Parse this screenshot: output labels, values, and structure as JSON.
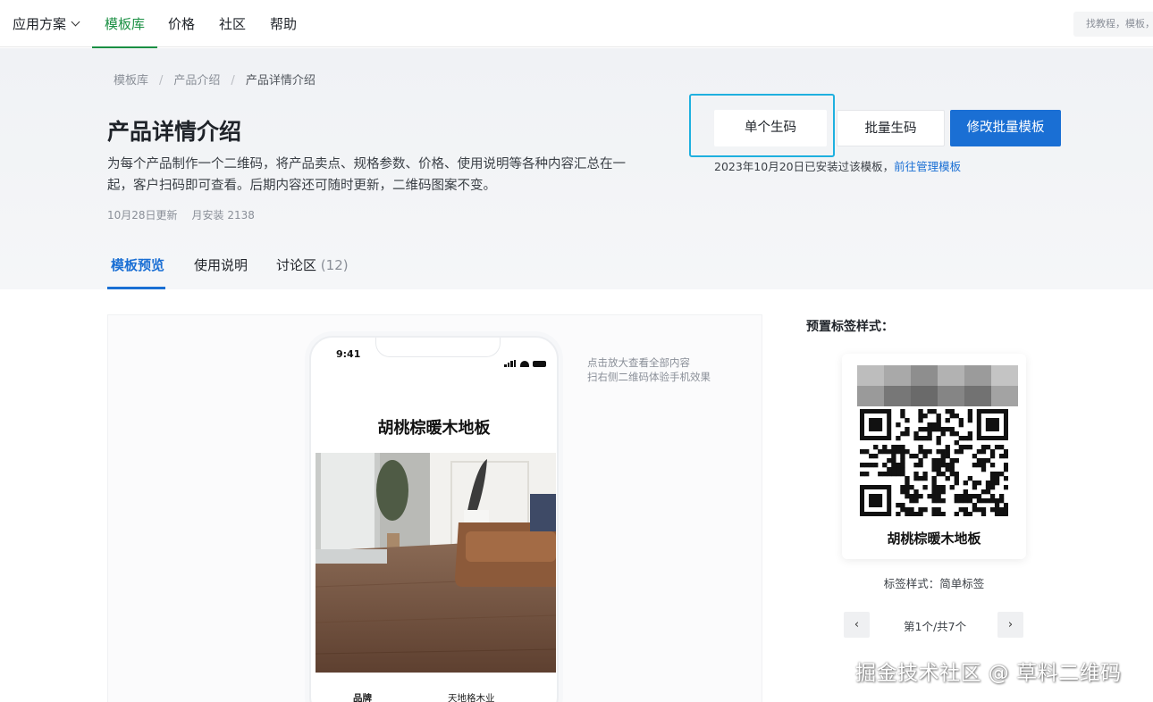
{
  "nav": {
    "items": [
      {
        "label": "应用方案",
        "has_dropdown": true
      },
      {
        "label": "模板库",
        "active": true
      },
      {
        "label": "价格"
      },
      {
        "label": "社区"
      },
      {
        "label": "帮助"
      }
    ],
    "search_placeholder": "找教程，模板，"
  },
  "colors": {
    "accent_green": "#1a8f43",
    "primary_blue": "#1a6fd4",
    "focus_cyan": "#1fb0df"
  },
  "breadcrumb": [
    "模板库",
    "产品介绍",
    "产品详情介绍"
  ],
  "breadcrumb_sep": "/",
  "hero": {
    "title": "产品详情介绍",
    "description": "为每个产品制作一个二维码，将产品卖点、规格参数、价格、使用说明等各种内容汇总在一起，客户扫码即可查看。后期内容还可随时更新，二维码图案不变。",
    "updated": "10月28日更新",
    "installs": "月安装 2138"
  },
  "actions": {
    "single": "单个生码",
    "batch": "批量生码",
    "edit_batch": "修改批量模板",
    "install_note": "2023年10月20日已安装过该模板，",
    "manage_link": "前往管理模板"
  },
  "tabs": [
    {
      "label": "模板预览",
      "active": true
    },
    {
      "label": "使用说明"
    },
    {
      "label": "讨论区",
      "count": "(12)"
    }
  ],
  "preview": {
    "phone_time": "9:41",
    "product_title": "胡桃棕暖木地板",
    "spec_key": "品牌",
    "spec_value": "天地格木业",
    "hint_line1": "点击放大查看全部内容",
    "hint_line2": "扫右侧二维码体验手机效果"
  },
  "label_panel": {
    "title": "预置标签样式：",
    "label_name": "胡桃棕暖木地板",
    "style_caption": "标签样式：简单标签",
    "pager": "第1个/共7个",
    "prev": "‹",
    "next": "›"
  },
  "watermark": "掘金技术社区 @ 草料二维码"
}
